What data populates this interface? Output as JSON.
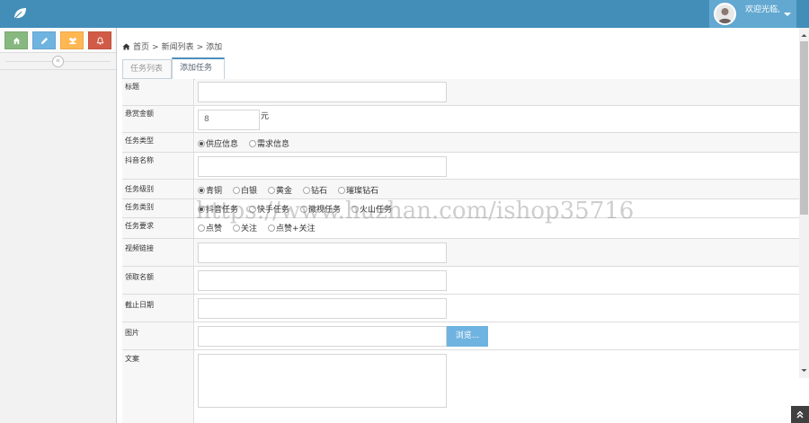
{
  "header": {
    "welcome": "欢迎光临,",
    "colors": {
      "navbar": "#438eb9",
      "user_box": "#62a8d1"
    }
  },
  "sidebar": {
    "shortcuts": [
      {
        "icon": "home-icon",
        "color": "#87b87f"
      },
      {
        "icon": "pencil-icon",
        "color": "#6fb3e0"
      },
      {
        "icon": "users-icon",
        "color": "#ffb752"
      },
      {
        "icon": "bell-icon",
        "color": "#d15b47"
      }
    ],
    "collapse_glyph": "«"
  },
  "breadcrumb": {
    "home": "首页",
    "sep": ">",
    "list": "新闻列表",
    "current": "添加"
  },
  "tabs": [
    {
      "label": "任务列表",
      "active": false
    },
    {
      "label": "添加任务",
      "active": true
    }
  ],
  "form": {
    "title_label": "标题",
    "reward_label": "悬赏金额",
    "reward_value": "8",
    "reward_unit": "元",
    "type_label": "任务类型",
    "type_options": [
      "供应信息",
      "需求信息"
    ],
    "douyin_label": "抖音名称",
    "level_label": "任务级别",
    "level_options": [
      "青铜",
      "白银",
      "黄金",
      "钻石",
      "璀璨钻石"
    ],
    "category_label": "任务类别",
    "category_options": [
      "抖音任务",
      "快手任务",
      "微视任务",
      "火山任务"
    ],
    "require_label": "任务要求",
    "require_options": [
      "点赞",
      "关注",
      "点赞+关注"
    ],
    "video_label": "视频链接",
    "quota_label": "领取名额",
    "deadline_label": "截止日期",
    "image_label": "图片",
    "browse_label": "浏览...",
    "copy_label": "文案"
  },
  "watermark": "https://www.huzhan.com/ishop35716"
}
